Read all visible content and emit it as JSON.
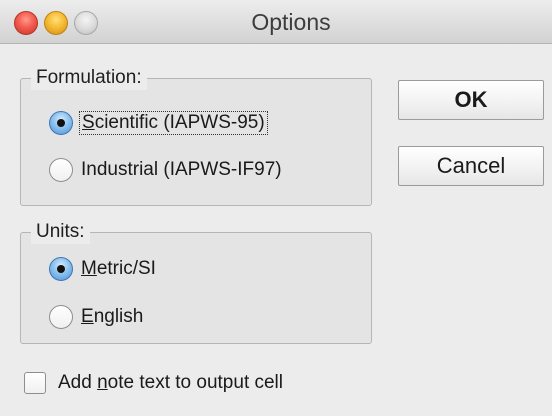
{
  "window": {
    "title": "Options"
  },
  "formulation": {
    "legend": "Formulation:",
    "options": [
      {
        "pre": "",
        "mnemonic": "S",
        "post": "cientific (IAPWS-95)",
        "checked": true
      },
      {
        "pre": "",
        "mnemonic": "I",
        "post": "ndustrial (IAPWS-IF97)",
        "checked": false
      }
    ]
  },
  "units": {
    "legend": "Units:",
    "options": [
      {
        "pre": "",
        "mnemonic": "M",
        "post": "etric/SI",
        "checked": true
      },
      {
        "pre": "",
        "mnemonic": "E",
        "post": "nglish",
        "checked": false
      }
    ]
  },
  "buttons": {
    "ok": "OK",
    "cancel": "Cancel"
  },
  "note_checkbox": {
    "pre": "Add ",
    "mnemonic": "n",
    "post": "ote text to output cell",
    "checked": false
  }
}
